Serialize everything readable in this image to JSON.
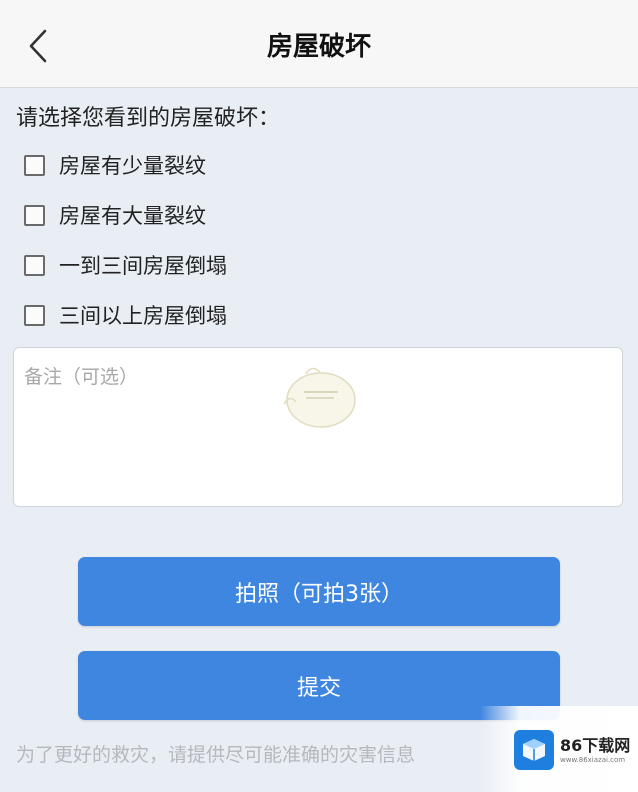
{
  "header": {
    "title": "房屋破坏"
  },
  "form": {
    "prompt": "请选择您看到的房屋破坏：",
    "options": [
      {
        "label": "房屋有少量裂纹",
        "checked": false
      },
      {
        "label": "房屋有大量裂纹",
        "checked": false
      },
      {
        "label": "一到三间房屋倒塌",
        "checked": false
      },
      {
        "label": "三间以上房屋倒塌",
        "checked": false
      }
    ],
    "notes": {
      "placeholder": "备注（可选）",
      "value": ""
    }
  },
  "buttons": {
    "photo_label": "拍照（可拍3张）",
    "submit_label": "提交"
  },
  "hint": "为了更好的救灾，请提供尽可能准确的灾害信息",
  "watermark": {
    "name": "86下载网",
    "url": "www.86xiazai.com"
  },
  "colors": {
    "accent": "#3f86e0",
    "background": "#e9eef5",
    "header": "#f7f7f7"
  },
  "icons": {
    "back": "chevron-left-icon",
    "brand": "box-icon"
  }
}
